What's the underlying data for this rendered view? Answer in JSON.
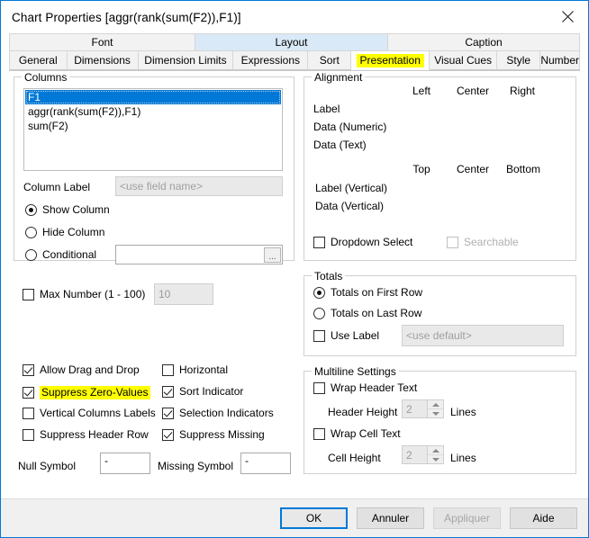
{
  "window": {
    "title": "Chart Properties [aggr(rank(sum(F2)),F1)]",
    "close_icon": "close-icon"
  },
  "tabs_top": [
    {
      "label": "Font",
      "selected": false
    },
    {
      "label": "Layout",
      "selected": true
    },
    {
      "label": "Caption",
      "selected": false
    }
  ],
  "tabs_bottom": [
    {
      "label": "General",
      "active": false,
      "highlighted": false
    },
    {
      "label": "Dimensions",
      "active": false,
      "highlighted": false
    },
    {
      "label": "Dimension Limits",
      "active": false,
      "highlighted": false
    },
    {
      "label": "Expressions",
      "active": false,
      "highlighted": false
    },
    {
      "label": "Sort",
      "active": false,
      "highlighted": false
    },
    {
      "label": "Presentation",
      "active": true,
      "highlighted": true
    },
    {
      "label": "Visual Cues",
      "active": false,
      "highlighted": false
    },
    {
      "label": "Style",
      "active": false,
      "highlighted": false
    },
    {
      "label": "Number",
      "active": false,
      "highlighted": false
    }
  ],
  "columns": {
    "legend": "Columns",
    "items": [
      {
        "text": "F1",
        "selected": true
      },
      {
        "text": "aggr(rank(sum(F2)),F1)",
        "selected": false
      },
      {
        "text": "sum(F2)",
        "selected": false
      }
    ],
    "column_label": {
      "label": "Column Label",
      "value": "",
      "placeholder": "<use field name>"
    },
    "visibility": [
      {
        "label": "Show Column",
        "checked": true
      },
      {
        "label": "Hide Column",
        "checked": false
      },
      {
        "label": "Conditional",
        "checked": false
      }
    ],
    "conditional_value": "",
    "ellipsis_label": "..."
  },
  "max_number": {
    "label": "Max Number (1 - 100)",
    "checked": false,
    "value": "10"
  },
  "left_checks_col1": [
    {
      "label": "Allow Drag and Drop",
      "checked": true,
      "highlighted": false
    },
    {
      "label": "Suppress Zero-Values",
      "checked": true,
      "highlighted": true
    },
    {
      "label": "Vertical Columns Labels",
      "checked": false,
      "highlighted": false
    },
    {
      "label": "Suppress Header Row",
      "checked": false,
      "highlighted": false
    }
  ],
  "left_checks_col2": [
    {
      "label": "Horizontal",
      "checked": false,
      "highlighted": false
    },
    {
      "label": "Sort Indicator",
      "checked": true,
      "highlighted": false
    },
    {
      "label": "Selection Indicators",
      "checked": true,
      "highlighted": false
    },
    {
      "label": "Suppress Missing",
      "checked": true,
      "highlighted": false
    }
  ],
  "symbols": {
    "null_label": "Null Symbol",
    "null_value": "-",
    "missing_label": "Missing Symbol",
    "missing_value": "-"
  },
  "alignment": {
    "legend": "Alignment",
    "headers_h": [
      "Left",
      "Center",
      "Right"
    ],
    "headers_v": [
      "Top",
      "Center",
      "Bottom"
    ],
    "rows_h": [
      {
        "label": "Label",
        "selected": 0
      },
      {
        "label": "Data (Numeric)",
        "selected": 2
      },
      {
        "label": "Data (Text)",
        "selected": 0
      }
    ],
    "rows_v": [
      {
        "label": "Label (Vertical)",
        "selected": 1
      },
      {
        "label": "Data (Vertical)",
        "selected": 1
      }
    ]
  },
  "dropdown_select": {
    "label": "Dropdown Select",
    "checked": false
  },
  "searchable": {
    "label": "Searchable",
    "checked": false,
    "disabled": true
  },
  "totals": {
    "legend": "Totals",
    "options": [
      {
        "label": "Totals on First Row",
        "checked": true
      },
      {
        "label": "Totals on Last Row",
        "checked": false
      }
    ],
    "use_label": {
      "label": "Use Label",
      "checked": false
    },
    "use_label_value": "",
    "use_label_placeholder": "<use default>"
  },
  "multiline": {
    "legend": "Multiline Settings",
    "wrap_header": {
      "label": "Wrap Header Text",
      "checked": false
    },
    "header_height_label": "Header Height",
    "header_height_value": "2",
    "header_lines_label": "Lines",
    "wrap_cell": {
      "label": "Wrap Cell Text",
      "checked": false
    },
    "cell_height_label": "Cell Height",
    "cell_height_value": "2",
    "cell_lines_label": "Lines"
  },
  "footer": {
    "ok": "OK",
    "cancel": "Annuler",
    "apply": "Appliquer",
    "help": "Aide"
  },
  "colors": {
    "accent": "#0078d7",
    "highlight": "#ffff00",
    "window_bg": "#ffffff",
    "footer_bg": "#f0f0f0"
  }
}
